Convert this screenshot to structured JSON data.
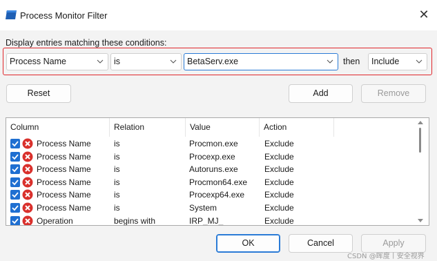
{
  "window": {
    "title": "Process Monitor Filter",
    "close_glyph": "✕"
  },
  "conditions": {
    "label": "Display entries matching these conditions:",
    "column_value": "Process Name",
    "relation_value": "is",
    "value_text": "BetaServ.exe",
    "then_label": "then",
    "action_value": "Include"
  },
  "buttons": {
    "reset": "Reset",
    "add": "Add",
    "remove": "Remove",
    "ok": "OK",
    "cancel": "Cancel",
    "apply": "Apply"
  },
  "table": {
    "headers": [
      "Column",
      "Relation",
      "Value",
      "Action"
    ],
    "rows": [
      {
        "column": "Process Name",
        "relation": "is",
        "value": "Procmon.exe",
        "action": "Exclude"
      },
      {
        "column": "Process Name",
        "relation": "is",
        "value": "Procexp.exe",
        "action": "Exclude"
      },
      {
        "column": "Process Name",
        "relation": "is",
        "value": "Autoruns.exe",
        "action": "Exclude"
      },
      {
        "column": "Process Name",
        "relation": "is",
        "value": "Procmon64.exe",
        "action": "Exclude"
      },
      {
        "column": "Process Name",
        "relation": "is",
        "value": "Procexp64.exe",
        "action": "Exclude"
      },
      {
        "column": "Process Name",
        "relation": "is",
        "value": "System",
        "action": "Exclude"
      },
      {
        "column": "Operation",
        "relation": "begins with",
        "value": "IRP_MJ_",
        "action": "Exclude"
      }
    ]
  },
  "watermark": "CSDN @晖度丨安全视界",
  "colors": {
    "accent": "#1f6fd1",
    "highlight_border": "#e0262b",
    "exclude_icon": "#d9302c",
    "dialog_bg": "#f3f3f3"
  },
  "icons": {
    "app": "process-monitor-filter-icon",
    "row_checkbox": "checkbox-checked-icon",
    "row_action": "exclude-x-icon",
    "dropdown": "chevron-down-icon"
  }
}
